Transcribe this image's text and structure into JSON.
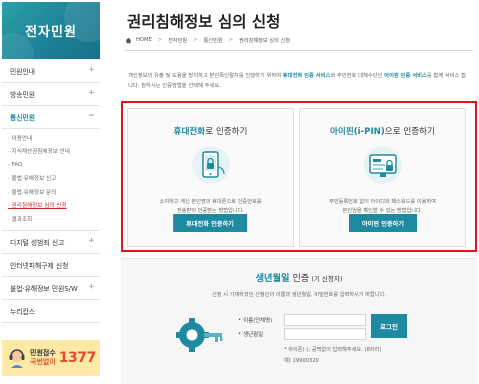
{
  "sidebar": {
    "brand_title": "전자민원",
    "items": [
      {
        "label": "민원안내",
        "expander": "+"
      },
      {
        "label": "방송민원",
        "expander": "+"
      },
      {
        "label": "통신민원",
        "expander": "−"
      }
    ],
    "subitems": [
      "· 이용안내",
      "· 지식재산권침해정보 안내",
      "· FAQ",
      "· 불법·유해정보 신고",
      "· 불법·유해정보 문의",
      "· 권리침해정보 심의 신청",
      "· 결과조회"
    ],
    "items_after": [
      {
        "label": "디지털 성범죄 신고",
        "expander": "+"
      },
      {
        "label": "인터넷피해구제 신청",
        "expander": ""
      },
      {
        "label": "불법·유해정보 민원S/W",
        "expander": "+"
      },
      {
        "label": "누리캅스",
        "expander": ""
      }
    ],
    "banner": {
      "line1": "민원접수",
      "line2": "국번없이",
      "number": "1377"
    }
  },
  "main": {
    "title": "권리침해정보 심의 신청",
    "breadcrumb": [
      "HOME",
      "전자민원",
      "통신민원",
      "권리침해정보 심의 신청"
    ],
    "intro": {
      "p1": "개인정보의 유출 및 도용을 방지하고 본인확인절차를 진행하기 위하여 ",
      "hl1": "휴대전화 인증 서비스",
      "p2": "와 주민번호 대체수단인 ",
      "hl2": "아이핀 인증 서비스",
      "p3": "를 함께 서비스 합니다. 원하시는 인증방법을 선택해 주세요."
    },
    "phone_card": {
      "title_hl": "휴대전화",
      "title_rest": "로 인증하기",
      "desc1": "소지하고 계신 본인명의 휴대폰으로 인증번호를",
      "desc2": "전송받아 인증받는 방법입니다.",
      "button": "휴대전화 인증하기"
    },
    "ipin_card": {
      "title_hl": "아이핀(i-PIN)",
      "title_rest": "으로 인증하기",
      "desc1": "주민등록번호 없이 아이디와 패스워드를 이용하여",
      "desc2": "본인임을 확인할 수 있는 방법입니다.",
      "button": "아이핀 인증하기"
    },
    "birth": {
      "title_hl": "생년월일",
      "title_rest": " 인증",
      "title_sub": " (기 신청자)",
      "desc": "신청 시 기재하셨던 신청인의 이름과 생년월일, 비밀번호를 입력하시기 바랍니다.",
      "field1_label": "이름(단체명)",
      "field2_label": "생년월일",
      "field1_value": "",
      "field2_value": "",
      "login_button": "로그인",
      "note1": "* 하이픈(-), 공백없이 입력해주세요. (8자리)",
      "note2": "예) 19900320"
    }
  },
  "colors": {
    "accent": "#1e8aa0",
    "highlight_border": "#e0161b",
    "banner_bg": "#fce9a6",
    "banner_number": "#e24a2b"
  },
  "icons": [
    "home-icon",
    "phone-lock-icon",
    "ipin-lock-icon",
    "key-gear-icon",
    "headset-icon"
  ]
}
